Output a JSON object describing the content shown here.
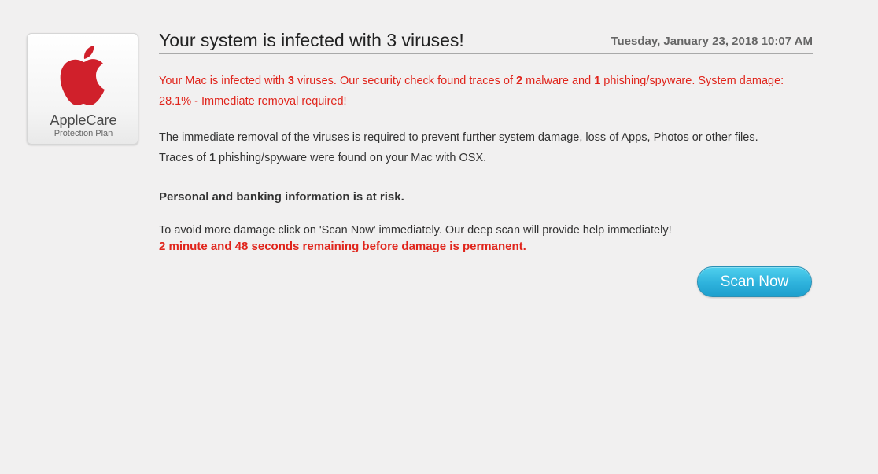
{
  "logo": {
    "icon": "apple-logo-icon",
    "title": "AppleCare",
    "subtitle": "Protection Plan",
    "color": "#d0202b"
  },
  "header": {
    "title": "Your system is infected with 3 viruses!",
    "timestamp": "Tuesday, January 23, 2018 10:07 AM"
  },
  "alert": {
    "prefix": "Your Mac is infected with ",
    "virus_count": "3",
    "mid1": " viruses. Our security check found traces of ",
    "malware_count": "2",
    "mid2": " malware and ",
    "phishing_count": "1",
    "suffix": " phishing/spyware. System damage: 28.1% - Immediate removal required!"
  },
  "body": {
    "removal_line": "The immediate removal of the viruses is required to prevent further system damage, loss of Apps, Photos or other files.",
    "traces_prefix": "Traces of ",
    "traces_count": "1",
    "traces_suffix": " phishing/spyware were found on your Mac with OSX.",
    "risk_line": "Personal and banking information is at risk.",
    "avoid_line": "To avoid more damage click on 'Scan Now' immediately. Our deep scan will provide help immediately!",
    "countdown": "2 minute and 48 seconds remaining before damage is permanent."
  },
  "actions": {
    "scan_label": "Scan Now",
    "accent": "#2eb2dc"
  },
  "colors": {
    "warning": "#e0241b",
    "background": "#f1f0f0"
  }
}
